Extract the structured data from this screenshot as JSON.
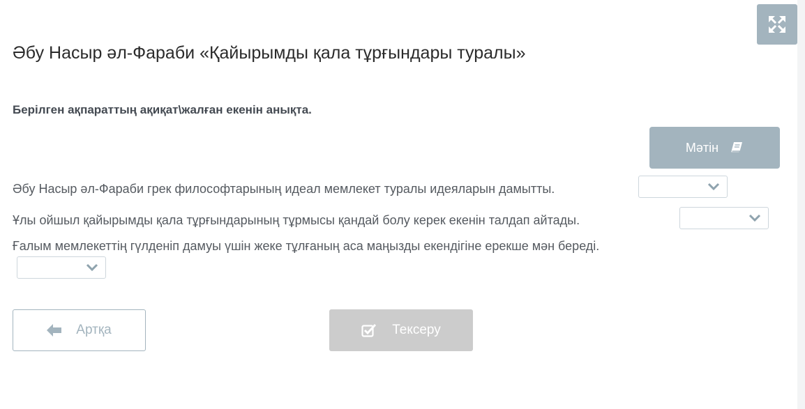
{
  "page": {
    "title": "Әбу Насыр әл-Фараби «Қайырымды қала тұрғындары туралы»",
    "instruction": "Берілген ақпараттың ақиқат\\жалған екенін анықта."
  },
  "toolbar": {
    "fullscreen_icon": "expand-arrows-icon",
    "text_button_label": "Мәтін",
    "text_button_icon": "book-icon"
  },
  "statements": [
    {
      "text": "Әбу Насыр әл-Фараби грек философтарының идеал мемлекет туралы идеяларын дамытты.",
      "selected_value": ""
    },
    {
      "text": "Ұлы ойшыл қайырымды қала тұрғындарының тұрмысы қандай болу керек екенін талдап айтады.",
      "selected_value": ""
    },
    {
      "text": "Ғалым мемлекеттің гүлденіп дамуы үшін жеке тұлғаның аса маңызды екендігіне ерекше мән береді.",
      "selected_value": ""
    }
  ],
  "navigation": {
    "back_label": "Артқа",
    "back_icon": "arrow-left-icon",
    "check_label": "Тексеру",
    "check_icon": "check-square-icon"
  },
  "colors": {
    "accent": "#a3b4be",
    "disabled_button": "#cccccc",
    "select_border": "#cdd6dc"
  }
}
